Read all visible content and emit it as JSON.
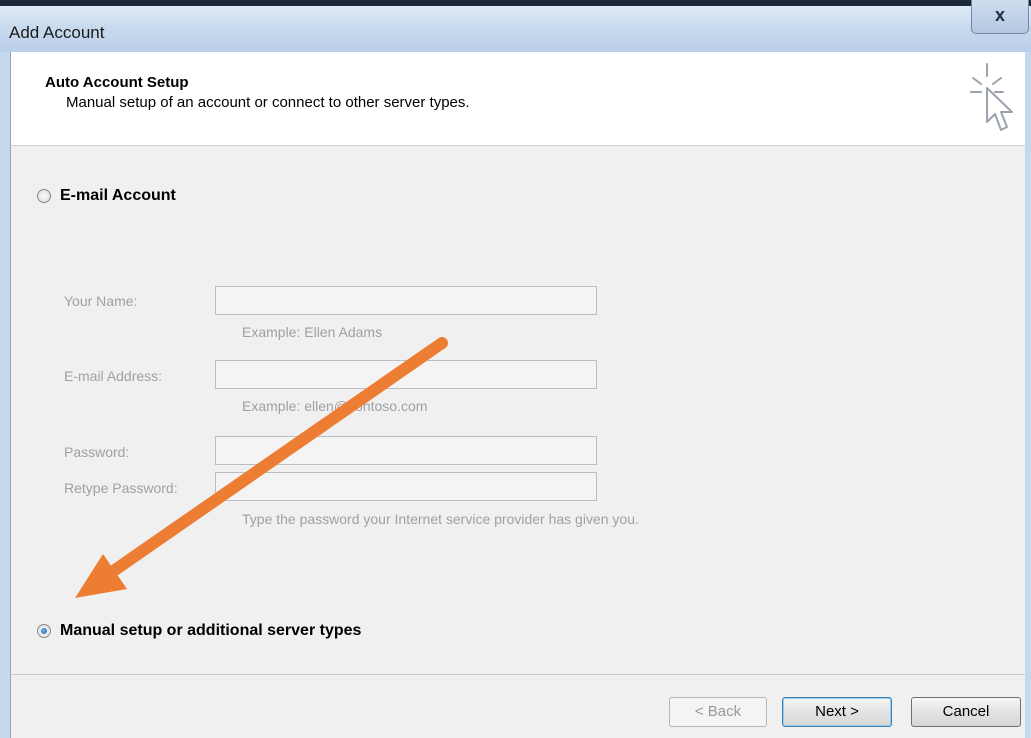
{
  "window": {
    "title": "Add Account",
    "close_label": "x"
  },
  "header": {
    "title": "Auto Account Setup",
    "subtitle": "Manual setup of an account or connect to other server types.",
    "icon": "cursor-sparkle-icon"
  },
  "options": {
    "email_account": {
      "label": "E-mail Account",
      "selected": false
    },
    "manual_setup": {
      "label": "Manual setup or additional server types",
      "selected": true
    }
  },
  "fields": {
    "your_name": {
      "label": "Your Name:",
      "value": "",
      "hint": "Example: Ellen Adams"
    },
    "email_address": {
      "label": "E-mail Address:",
      "value": "",
      "hint": "Example: ellen@contoso.com"
    },
    "password": {
      "label": "Password:",
      "value": ""
    },
    "retype_password": {
      "label": "Retype Password:",
      "value": "",
      "hint": "Type the password your Internet service provider has given you."
    }
  },
  "footer": {
    "back_label": "< Back",
    "next_label": "Next >",
    "cancel_label": "Cancel"
  },
  "colors": {
    "annotation_arrow": "#ee7d34"
  }
}
